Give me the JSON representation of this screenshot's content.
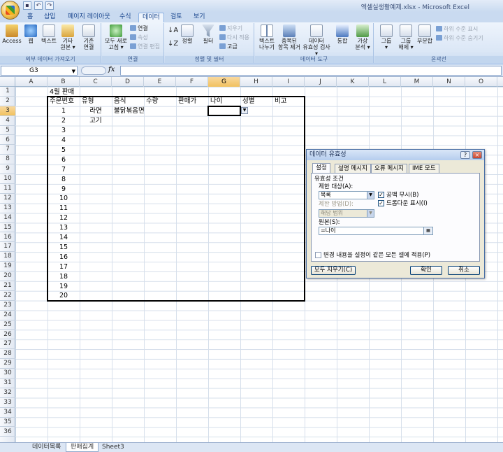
{
  "window": {
    "title": "엑셀실생활예제.xlsx - Microsoft Excel"
  },
  "qat": [
    "save",
    "undo",
    "redo"
  ],
  "tabs": [
    "홈",
    "삽입",
    "페이지 레이아웃",
    "수식",
    "데이터",
    "검토",
    "보기"
  ],
  "active_tab": "데이터",
  "ribbon": {
    "g1": {
      "label": "외부 데이터 가져오기",
      "access": "Access",
      "web": "웹",
      "text": "텍스트",
      "other_l1": "기타",
      "other_l2": "원본 ▾",
      "existing_l1": "기존",
      "existing_l2": "연결"
    },
    "g2": {
      "label": "연결",
      "refresh_l1": "모두 새로",
      "refresh_l2": "고침 ▾",
      "conn": "연결",
      "props": "속성",
      "edit_links": "연결 편집"
    },
    "g3": {
      "label": "정렬 및 필터",
      "sort": "정렬",
      "filter": "필터",
      "clear": "지우기",
      "reapply": "다시 적용",
      "advanced": "고급"
    },
    "g4": {
      "label": "데이터 도구",
      "ttc_l1": "텍스트",
      "ttc_l2": "나누기",
      "dup_l1": "중복된",
      "dup_l2": "항목 제거",
      "val_l1": "데이터",
      "val_l2": "유효성 검사 ▾",
      "consol": "통합",
      "whatif_l1": "가상",
      "whatif_l2": "분석 ▾"
    },
    "g5": {
      "label": "윤곽선",
      "group_l1": "그룹",
      "group_l2": "▾",
      "ungroup_l1": "그룹",
      "ungroup_l2": "해제 ▾",
      "subtotal": "부분합",
      "show": "하위 수준 표시",
      "hide": "하위 수준 숨기기"
    }
  },
  "namebox": "G3",
  "formula": "",
  "columns": [
    "A",
    "B",
    "C",
    "D",
    "E",
    "F",
    "G",
    "H",
    "I",
    "J",
    "K",
    "L",
    "M",
    "N",
    "O"
  ],
  "selected_col": "G",
  "selected_row": 3,
  "rows_visible": 36,
  "sheet": {
    "title": "4월 판매",
    "headers": [
      "주문번호",
      "유형",
      "음식",
      "수량",
      "판매가",
      "나이",
      "성별",
      "비고"
    ],
    "order_numbers": [
      "1",
      "2",
      "3",
      "4",
      "5",
      "6",
      "7",
      "8",
      "9",
      "10",
      "11",
      "12",
      "13",
      "14",
      "15",
      "16",
      "17",
      "18",
      "19",
      "20"
    ],
    "r3_type": "라면",
    "r3_food": "불닭볶음면",
    "r4_type": "고기"
  },
  "sheet_tabs": [
    "데이터목록",
    "판매집계",
    "Sheet3"
  ],
  "active_sheet": "판매집계",
  "dialog": {
    "title": "데이터 유효성",
    "help": "?",
    "close": "×",
    "tabs": [
      "설정",
      "설명 메시지",
      "오류 메시지",
      "IME 모드"
    ],
    "section": "유효성 조건",
    "allow_label": "제한 대상(A):",
    "allow_value": "목록",
    "ignore_blank": "공백 무시(B)",
    "dropdown": "드롭다운 표시(I)",
    "data_label": "제한 방법(D):",
    "data_value": "해당 범위",
    "source_label": "원본(S):",
    "source_value": "=나이",
    "apply_all": "변경 내용을 설정이 같은 모든 셀에 적용(P)",
    "clear_all": "모두 지우기(C)",
    "ok": "확인",
    "cancel": "취소"
  },
  "colors": {
    "accent": "#f1c15f",
    "ribbon": "#dbe7f6",
    "titlebar": "#c9daf0"
  }
}
